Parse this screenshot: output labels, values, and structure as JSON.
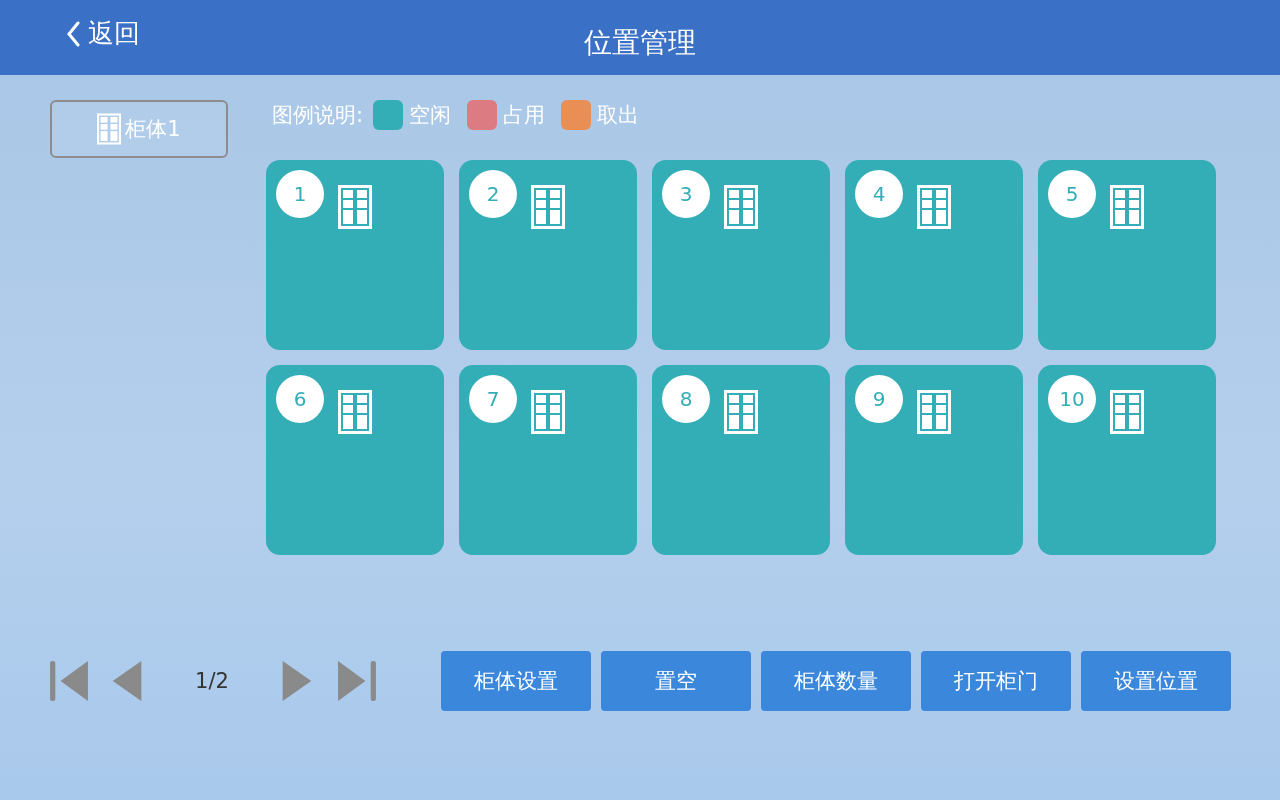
{
  "header": {
    "back": "返回",
    "title": "位置管理"
  },
  "cabinets": [
    {
      "label": "柜体1",
      "selected": true
    }
  ],
  "legend": {
    "label": "图例说明:",
    "items": [
      {
        "label": "空闲",
        "color": "#33adb6"
      },
      {
        "label": "占用",
        "color": "#dd7b82"
      },
      {
        "label": "取出",
        "color": "#e98f55"
      }
    ]
  },
  "slots": [
    {
      "number": "1",
      "color": "#33adb6"
    },
    {
      "number": "2",
      "color": "#33adb6"
    },
    {
      "number": "3",
      "color": "#33adb6"
    },
    {
      "number": "4",
      "color": "#33adb6"
    },
    {
      "number": "5",
      "color": "#33adb6"
    },
    {
      "number": "6",
      "color": "#33adb6"
    },
    {
      "number": "7",
      "color": "#33adb6"
    },
    {
      "number": "8",
      "color": "#33adb6"
    },
    {
      "number": "9",
      "color": "#33adb6"
    },
    {
      "number": "10",
      "color": "#33adb6"
    }
  ],
  "pager": {
    "page": "1/2"
  },
  "buttons": [
    "柜体设置",
    "置空",
    "柜体数量",
    "打开柜门",
    "设置位置"
  ]
}
